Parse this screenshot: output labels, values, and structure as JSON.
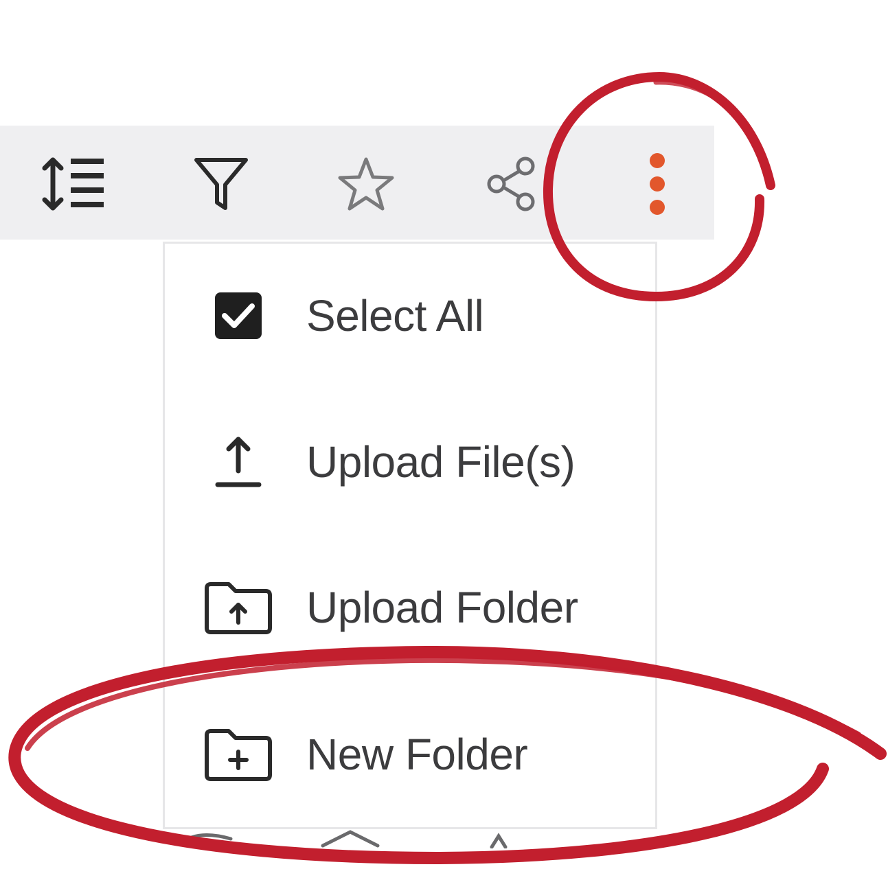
{
  "toolbar": {
    "icons": {
      "sort": "sort-lines-icon",
      "filter": "filter-funnel-icon",
      "favorite": "star-outline-icon",
      "share": "share-nodes-icon",
      "more": "more-vertical-dots-icon"
    },
    "more_color": "#e2572c"
  },
  "menu": {
    "items": [
      {
        "label": "Select All",
        "icon": "checkbox-checked-icon"
      },
      {
        "label": "Upload File(s)",
        "icon": "upload-arrow-icon"
      },
      {
        "label": "Upload Folder",
        "icon": "folder-upload-icon"
      },
      {
        "label": "New Folder",
        "icon": "folder-plus-icon"
      }
    ]
  },
  "annotation": {
    "color": "#c21f2e"
  }
}
